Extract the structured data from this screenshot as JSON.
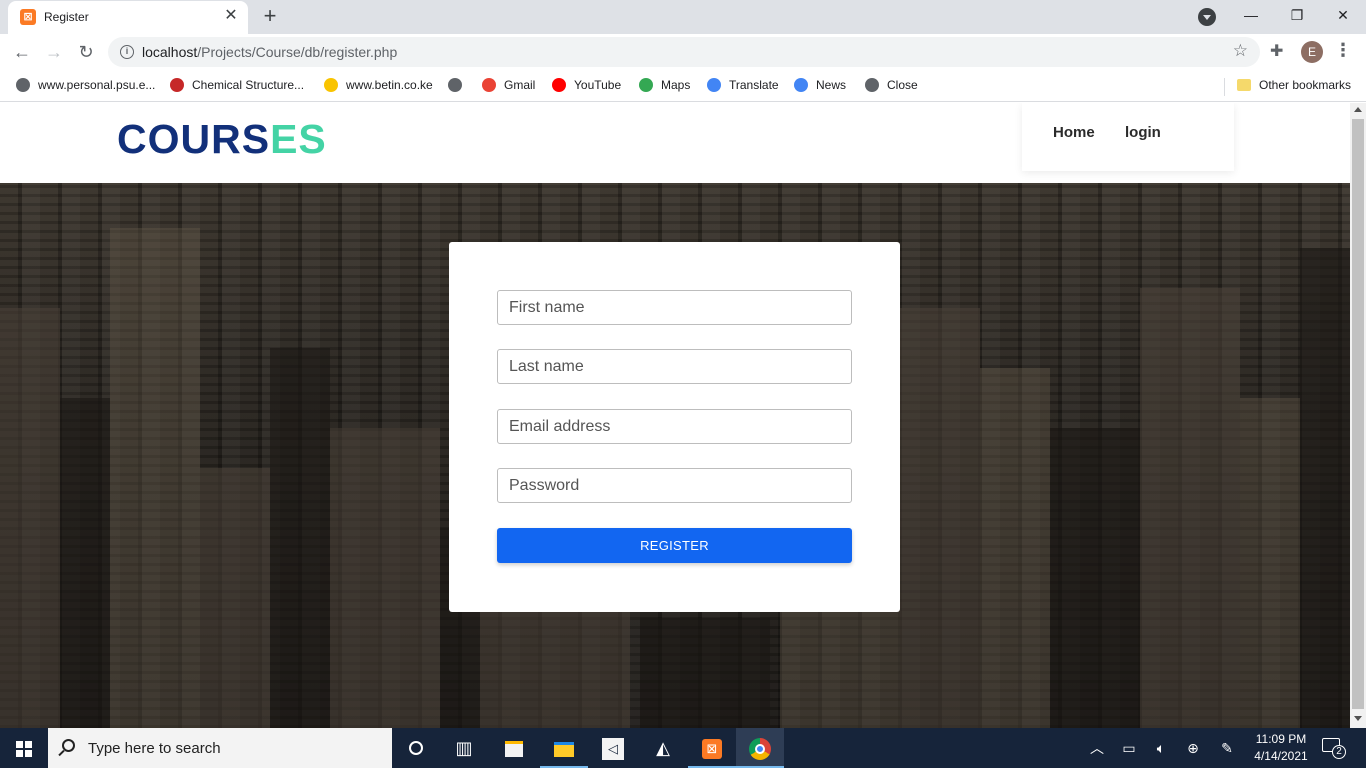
{
  "browser": {
    "tab_title": "Register",
    "tab_favicon_glyph": "⊠",
    "new_tab_glyph": "+",
    "url_host": "localhost",
    "url_path": "/Projects/Course/db/register.php",
    "profile_initial": "E",
    "window_controls": {
      "minimize": "—",
      "restore": "❐",
      "close": "✕"
    }
  },
  "bookmarks": [
    {
      "label": "www.personal.psu.e...",
      "icon": "globe-icon",
      "color": "#5f6368"
    },
    {
      "label": "Chemical Structure...",
      "icon": "chemical-icon",
      "color": "#c62828"
    },
    {
      "label": "www.betin.co.ke",
      "icon": "betin-icon",
      "color": "#f9c400"
    },
    {
      "label": "",
      "icon": "globe-icon",
      "color": "#5f6368"
    },
    {
      "label": "Gmail",
      "icon": "gmail-icon",
      "color": "#ea4335"
    },
    {
      "label": "YouTube",
      "icon": "youtube-icon",
      "color": "#ff0000"
    },
    {
      "label": "Maps",
      "icon": "maps-icon",
      "color": "#34a853"
    },
    {
      "label": "Translate",
      "icon": "translate-icon",
      "color": "#4285f4"
    },
    {
      "label": "News",
      "icon": "news-icon",
      "color": "#4285f4"
    },
    {
      "label": "Close",
      "icon": "globe-icon",
      "color": "#5f6368"
    }
  ],
  "other_bookmarks": "Other bookmarks",
  "site": {
    "logo_part1": "COURS",
    "logo_part2": "ES",
    "logo_color1": "#12307a",
    "logo_color2": "#44d3a5",
    "nav": {
      "home": "Home",
      "login": "login"
    }
  },
  "form": {
    "first_name_placeholder": "First name",
    "last_name_placeholder": "Last name",
    "email_placeholder": "Email address",
    "password_placeholder": "Password",
    "submit_label": "REGISTER",
    "submit_color": "#1266f1"
  },
  "taskbar": {
    "search_placeholder": "Type here to search",
    "time": "11:09 PM",
    "date": "4/14/2021",
    "notification_count": "2"
  }
}
